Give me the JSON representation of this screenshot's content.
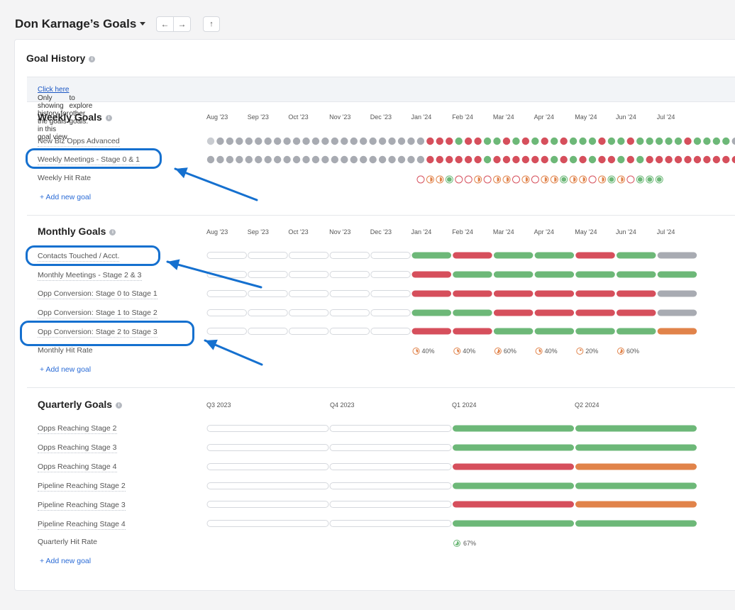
{
  "page_title": "Don Karnage’s Goals",
  "nav": {
    "back": "←",
    "forward": "→",
    "up": "↑"
  },
  "goal_history": {
    "heading": "Goal History",
    "notice_before": "Only showing history for the goals in this goal view.",
    "notice_link": "Click here",
    "notice_after": "to explore other goals."
  },
  "colors": {
    "green": "#6db878",
    "red": "#d64f5c",
    "orange": "#e1834a",
    "gray": "#a8abb2",
    "empty_border": "#d5d8dd",
    "highlight": "#1570cf"
  },
  "weekly": {
    "title": "Weekly Goals",
    "months": [
      "Aug '23",
      "Sep '23",
      "Oct '23",
      "Nov '23",
      "Dec '23",
      "Jan '24",
      "Feb '24",
      "Mar '24",
      "Apr '24",
      "May '24",
      "Jun '24",
      "Jul '24"
    ],
    "goals": [
      {
        "label": "New Biz Opps Advanced",
        "weeks": "Fxxxxxxxxxxxxxxxxxxxxxxrrrgrrggrgrgrgrgggrggrgggggrggggx"
      },
      {
        "label": "Weekly Meetings - Stage 0 & 1",
        "weeks": "xxxxxxxxxxxxxxxxxxxxxxxrrrrrrgrrrrrrgrgrgrrgrgrrrrrrrrrro"
      },
      {
        "label": "Weekly Hit Rate",
        "weeks": ""
      }
    ],
    "hit_rate": [
      0.0,
      0.5,
      0.5,
      1.0,
      0.0,
      0.0,
      0.5,
      0.0,
      0.5,
      0.5,
      0.0,
      0.5,
      0.0,
      0.5,
      0.5,
      1.0,
      0.5,
      0.5,
      0.0,
      0.5,
      1.0,
      0.5,
      0.0,
      1.0,
      1.0,
      1.0
    ],
    "add_label": "+ Add new goal"
  },
  "monthly": {
    "title": "Monthly Goals",
    "months": [
      "Aug '23",
      "Sep '23",
      "Oct '23",
      "Nov '23",
      "Dec '23",
      "Jan '24",
      "Feb '24",
      "Mar '24",
      "Apr '24",
      "May '24",
      "Jun '24",
      "Jul '24"
    ],
    "goals": [
      {
        "label": "Contacts Touched / Acct.",
        "months": [
          "e",
          "e",
          "e",
          "e",
          "e",
          "g",
          "r",
          "g",
          "g",
          "r",
          "g",
          "x"
        ]
      },
      {
        "label": "Monthly Meetings - Stage 2 & 3",
        "months": [
          "e",
          "e",
          "e",
          "e",
          "e",
          "r",
          "g",
          "g",
          "g",
          "g",
          "g",
          "g"
        ]
      },
      {
        "label": "Opp Conversion: Stage 0 to Stage 1",
        "months": [
          "e",
          "e",
          "e",
          "e",
          "e",
          "r",
          "r",
          "r",
          "r",
          "r",
          "r",
          "x"
        ]
      },
      {
        "label": "Opp Conversion: Stage 1 to Stage 2",
        "months": [
          "e",
          "e",
          "e",
          "e",
          "e",
          "g",
          "g",
          "r",
          "r",
          "r",
          "r",
          "x"
        ]
      },
      {
        "label": "Opp Conversion: Stage 2 to Stage 3",
        "months": [
          "e",
          "e",
          "e",
          "e",
          "e",
          "r",
          "r",
          "g",
          "g",
          "g",
          "g",
          "o"
        ]
      }
    ],
    "hit_rate_label": "Monthly Hit Rate",
    "hit_rate": [
      {
        "month_index": 5,
        "pct": "40%",
        "value": 0.4
      },
      {
        "month_index": 6,
        "pct": "40%",
        "value": 0.4
      },
      {
        "month_index": 7,
        "pct": "60%",
        "value": 0.6
      },
      {
        "month_index": 8,
        "pct": "40%",
        "value": 0.4
      },
      {
        "month_index": 9,
        "pct": "20%",
        "value": 0.2
      },
      {
        "month_index": 10,
        "pct": "60%",
        "value": 0.6
      }
    ],
    "add_label": "+ Add new goal"
  },
  "quarterly": {
    "title": "Quarterly Goals",
    "quarters": [
      "Q3 2023",
      "Q4 2023",
      "Q1 2024",
      "Q2 2024"
    ],
    "goals": [
      {
        "label": "Opps Reaching Stage 2",
        "quarters": [
          "e",
          "e",
          "g",
          "g"
        ]
      },
      {
        "label": "Opps Reaching Stage 3",
        "quarters": [
          "e",
          "e",
          "g",
          "g"
        ]
      },
      {
        "label": "Opps Reaching Stage 4",
        "quarters": [
          "e",
          "e",
          "r",
          "o"
        ]
      },
      {
        "label": "Pipeline Reaching Stage 2",
        "quarters": [
          "e",
          "e",
          "g",
          "g"
        ]
      },
      {
        "label": "Pipeline Reaching Stage 3",
        "quarters": [
          "e",
          "e",
          "r",
          "o"
        ]
      },
      {
        "label": "Pipeline Reaching Stage 4",
        "quarters": [
          "e",
          "e",
          "g",
          "g"
        ]
      }
    ],
    "hit_rate_label": "Quarterly Hit Rate",
    "hit_rate": [
      {
        "quarter_index": 2,
        "pct": "67%",
        "value": 0.67
      }
    ],
    "add_label": "+ Add new goal"
  }
}
